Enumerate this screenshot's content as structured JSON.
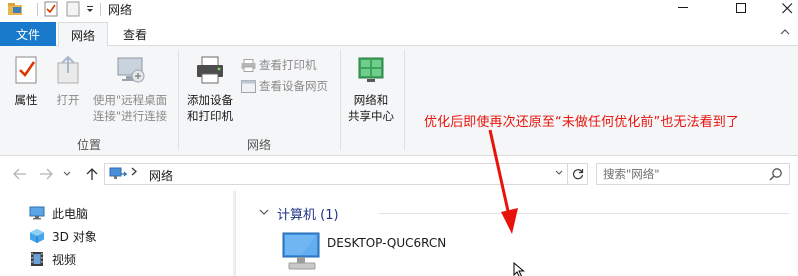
{
  "window": {
    "title": "网络",
    "controls": {
      "minimize": "─",
      "maximize": "☐",
      "close": "✕"
    }
  },
  "ribbon_tabs": [
    {
      "label": "文件",
      "active": false
    },
    {
      "label": "网络",
      "active": true
    },
    {
      "label": "查看",
      "active": false
    }
  ],
  "ribbon": {
    "location_group": {
      "label": "位置",
      "buttons": {
        "properties": "属性",
        "open": "打开",
        "remote_line1": "使用\"远程桌面",
        "remote_line2": "连接\"进行连接"
      }
    },
    "network_group": {
      "label": "网络",
      "add_device_line1": "添加设备",
      "add_device_line2": "和打印机",
      "view_printers": "查看打印机",
      "view_device_webpage": "查看设备网页"
    },
    "sharing_center": {
      "line1": "网络和",
      "line2": "共享中心"
    }
  },
  "annotation": {
    "text": "优化后即使再次还原至“未做任何优化前”也无法看到了",
    "color": "#e8140c"
  },
  "address_bar": {
    "location": "网络"
  },
  "search": {
    "placeholder": "搜索\"网络\""
  },
  "nav_pane": {
    "items": [
      {
        "label": "此电脑",
        "icon": "computer-icon"
      },
      {
        "label": "3D 对象",
        "icon": "3d-objects-icon"
      },
      {
        "label": "视频",
        "icon": "video-icon"
      }
    ]
  },
  "content": {
    "group_header": "计算机 (1)",
    "items": [
      {
        "name": "DESKTOP-QUC6RCN",
        "icon": "computer-icon"
      }
    ]
  },
  "colors": {
    "file_tab": "#1979ca",
    "ribbon_bg": "#f5f6f7",
    "group_header_text": "#1e3287",
    "annotation": "#e8140c"
  }
}
